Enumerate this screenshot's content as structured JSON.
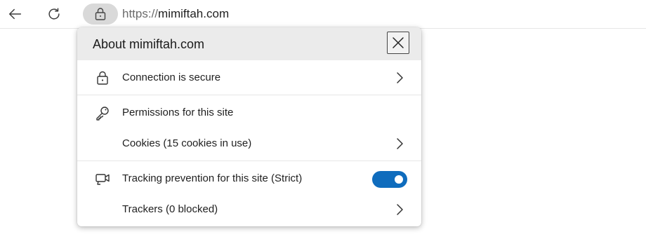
{
  "toolbar": {
    "back_icon": "back-arrow-icon",
    "refresh_icon": "refresh-icon",
    "lock_icon": "lock-icon",
    "url_scheme": "https://",
    "url_host": "mimiftah.com"
  },
  "popup": {
    "title": "About mimiftah.com",
    "close_icon": "close-icon",
    "rows": {
      "connection": {
        "label": "Connection is secure",
        "icon": "lock-icon"
      },
      "permissions": {
        "label": "Permissions for this site",
        "icon": "key-icon"
      },
      "cookies": {
        "label": "Cookies (15 cookies in use)"
      },
      "tracking": {
        "label": "Tracking prevention for this site (Strict)",
        "icon": "tracking-camera-icon",
        "enabled": true
      },
      "trackers": {
        "label": "Trackers (0 blocked)"
      }
    }
  },
  "colors": {
    "accent": "#0f6cbd",
    "header_bg": "#ebebeb",
    "lock_button_bg": "#d9d9d9"
  }
}
